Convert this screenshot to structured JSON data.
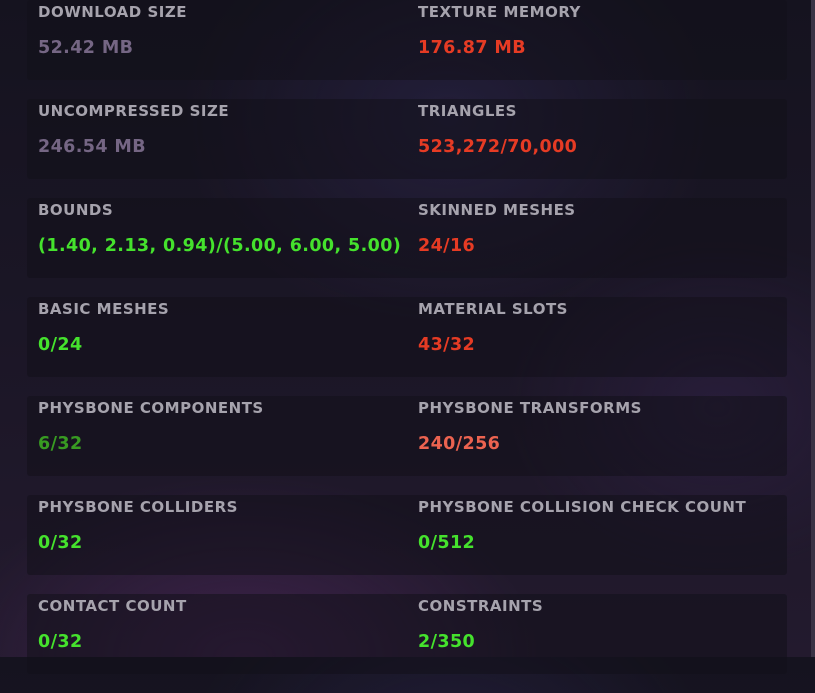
{
  "stats": [
    {
      "label": "DOWNLOAD SIZE",
      "value": "52.42 MB",
      "status": "muted"
    },
    {
      "label": "TEXTURE MEMORY",
      "value": "176.87 MB",
      "status": "red"
    },
    {
      "label": "UNCOMPRESSED SIZE",
      "value": "246.54 MB",
      "status": "muted"
    },
    {
      "label": "TRIANGLES",
      "value": "523,272/70,000",
      "status": "red"
    },
    {
      "label": "BOUNDS",
      "value": "(1.40, 2.13, 0.94)/(5.00, 6.00, 5.00)",
      "status": "green"
    },
    {
      "label": "SKINNED MESHES",
      "value": "24/16",
      "status": "red"
    },
    {
      "label": "BASIC MESHES",
      "value": "0/24",
      "status": "green"
    },
    {
      "label": "MATERIAL SLOTS",
      "value": "43/32",
      "status": "red"
    },
    {
      "label": "PHYSBONE COMPONENTS",
      "value": "6/32",
      "status": "dark-green"
    },
    {
      "label": "PHYSBONE TRANSFORMS",
      "value": "240/256",
      "status": "salmon"
    },
    {
      "label": "PHYSBONE COLLIDERS",
      "value": "0/32",
      "status": "green"
    },
    {
      "label": "PHYSBONE COLLISION CHECK COUNT",
      "value": "0/512",
      "status": "green"
    },
    {
      "label": "CONTACT COUNT",
      "value": "0/32",
      "status": "green"
    },
    {
      "label": "CONSTRAINTS",
      "value": "2/350",
      "status": "green"
    }
  ],
  "colors": {
    "label": "#a6a3ad",
    "muted": "#756684",
    "red": "#e63b24",
    "salmon": "#ec6350",
    "green": "#45e22d",
    "dark-green": "#389b22"
  }
}
